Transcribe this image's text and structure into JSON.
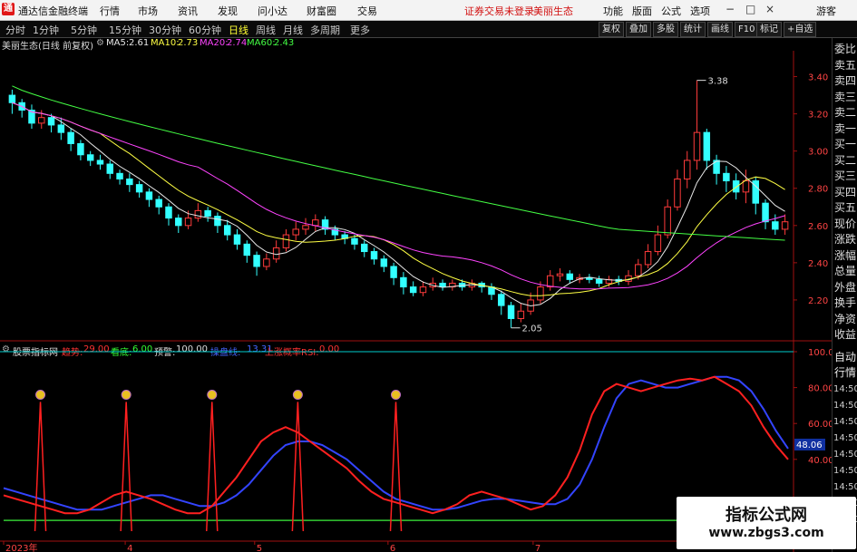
{
  "app": {
    "title": "通达信金融终端",
    "menu": [
      "行情",
      "市场",
      "资讯",
      "发现",
      "问小达",
      "财富圈",
      "交易"
    ],
    "alert": "证券交易未登录",
    "stock_alert": "美丽生态",
    "right_menu": [
      "功能",
      "版面",
      "公式",
      "选项",
      "游客"
    ],
    "window_controls": [
      "−",
      "□",
      "×"
    ]
  },
  "toolbar": {
    "periods": [
      "分时",
      "1分钟",
      "5分钟",
      "15分钟",
      "30分钟",
      "60分钟",
      "日线",
      "周线",
      "月线",
      "多周期",
      "更多"
    ],
    "active_period": "日线",
    "right_buttons": [
      "复权",
      "叠加",
      "多股",
      "统计",
      "画线",
      "F10",
      "标记",
      "+自选"
    ]
  },
  "kline_panel": {
    "stock_name": "美丽生态",
    "info": "(日线 前复权)",
    "ma": [
      {
        "label": "MA5:",
        "value": "2.61",
        "color": "#e8e8e8"
      },
      {
        "label": "MA10:",
        "value": "2.73",
        "color": "#ffff44"
      },
      {
        "label": "MA20:",
        "value": "2.74",
        "color": "#ff44ff"
      },
      {
        "label": "MA60:",
        "value": "2.43",
        "color": "#44ff44"
      }
    ],
    "price_ticks": [
      "3.40",
      "3.20",
      "3.00",
      "2.80",
      "2.60",
      "2.40",
      "2.20"
    ],
    "high_label": "3.38",
    "low_label": "2.05"
  },
  "indicator_panel": {
    "name": "股票指标网",
    "fields": [
      {
        "label": "趋势:",
        "value": "29.00",
        "color": "#ff3333"
      },
      {
        "label": "看底:",
        "value": "6.00",
        "color": "#33ff33"
      },
      {
        "label": "预警:",
        "value": "100.00",
        "color": "#dddddd"
      },
      {
        "label": "操盘线:",
        "value": "13.31",
        "color": "#4466ff"
      },
      {
        "label": "上涨概率RSI:",
        "value": "0.00",
        "color": "#ff3333"
      }
    ],
    "ticks": [
      "100.00",
      "80.00",
      "60.00",
      "40.00"
    ],
    "current_marker": "48.06"
  },
  "x_axis": {
    "labels": [
      "2023年",
      "4",
      "5",
      "6",
      "7"
    ]
  },
  "right_panel": {
    "upper": [
      "委比",
      "卖五",
      "卖四",
      "卖三",
      "卖二",
      "卖一",
      "买一",
      "买二",
      "买三",
      "买四",
      "买五",
      "现价",
      "涨跌",
      "涨幅",
      "总量",
      "外盘",
      "换手",
      "净资",
      "收益"
    ],
    "lower_head": [
      "自动",
      "行情"
    ],
    "times": [
      "14:50",
      "14:50",
      "14:50",
      "14:50",
      "14:50",
      "14:50",
      "14:50",
      "14:50",
      "14:50"
    ]
  },
  "watermark": {
    "line1": "指标公式网",
    "line2": "www.zbgs3.com"
  },
  "colors": {
    "up": "#ff3b3b",
    "down": "#33ffff",
    "ma5": "#e8e8e8",
    "ma10": "#ffff44",
    "ma20": "#ff44ff",
    "ma60": "#44ff44",
    "trend": "#ff2020",
    "operate": "#3344ff",
    "bottom": "#33cc33",
    "warn": "#00cccc",
    "axis": "#a01010"
  },
  "chart_data": {
    "type": "candlestick",
    "period": "daily",
    "y_range": [
      2.05,
      3.45
    ],
    "ma_values": {
      "MA5": 2.61,
      "MA10": 2.73,
      "MA20": 2.74,
      "MA60": 2.43
    },
    "candles": [
      [
        3.3,
        3.26,
        3.33,
        3.2
      ],
      [
        3.26,
        3.22,
        3.28,
        3.18
      ],
      [
        3.22,
        3.15,
        3.25,
        3.12
      ],
      [
        3.15,
        3.18,
        3.22,
        3.12
      ],
      [
        3.18,
        3.14,
        3.2,
        3.1
      ],
      [
        3.14,
        3.1,
        3.18,
        3.06
      ],
      [
        3.1,
        3.04,
        3.12,
        3.0
      ],
      [
        3.04,
        2.98,
        3.06,
        2.95
      ],
      [
        2.98,
        2.95,
        3.0,
        2.92
      ],
      [
        2.95,
        2.93,
        2.98,
        2.9
      ],
      [
        2.93,
        2.88,
        2.95,
        2.85
      ],
      [
        2.88,
        2.85,
        2.9,
        2.82
      ],
      [
        2.85,
        2.82,
        2.88,
        2.78
      ],
      [
        2.82,
        2.78,
        2.84,
        2.75
      ],
      [
        2.78,
        2.74,
        2.8,
        2.7
      ],
      [
        2.74,
        2.7,
        2.76,
        2.66
      ],
      [
        2.7,
        2.64,
        2.72,
        2.6
      ],
      [
        2.64,
        2.6,
        2.66,
        2.56
      ],
      [
        2.6,
        2.64,
        2.68,
        2.58
      ],
      [
        2.64,
        2.68,
        2.72,
        2.62
      ],
      [
        2.68,
        2.65,
        2.7,
        2.62
      ],
      [
        2.65,
        2.6,
        2.67,
        2.56
      ],
      [
        2.6,
        2.55,
        2.63,
        2.52
      ],
      [
        2.55,
        2.5,
        2.58,
        2.47
      ],
      [
        2.5,
        2.44,
        2.52,
        2.4
      ],
      [
        2.44,
        2.38,
        2.46,
        2.33
      ],
      [
        2.38,
        2.42,
        2.45,
        2.36
      ],
      [
        2.42,
        2.48,
        2.52,
        2.4
      ],
      [
        2.48,
        2.55,
        2.58,
        2.46
      ],
      [
        2.55,
        2.58,
        2.62,
        2.52
      ],
      [
        2.58,
        2.6,
        2.64,
        2.55
      ],
      [
        2.6,
        2.63,
        2.66,
        2.57
      ],
      [
        2.63,
        2.58,
        2.65,
        2.55
      ],
      [
        2.58,
        2.55,
        2.6,
        2.52
      ],
      [
        2.55,
        2.53,
        2.57,
        2.5
      ],
      [
        2.53,
        2.5,
        2.55,
        2.47
      ],
      [
        2.5,
        2.46,
        2.52,
        2.43
      ],
      [
        2.46,
        2.42,
        2.48,
        2.39
      ],
      [
        2.42,
        2.38,
        2.44,
        2.35
      ],
      [
        2.38,
        2.32,
        2.4,
        2.28
      ],
      [
        2.32,
        2.27,
        2.35,
        2.23
      ],
      [
        2.27,
        2.24,
        2.3,
        2.22
      ],
      [
        2.24,
        2.27,
        2.3,
        2.22
      ],
      [
        2.27,
        2.29,
        2.32,
        2.25
      ],
      [
        2.29,
        2.27,
        2.31,
        2.25
      ],
      [
        2.27,
        2.29,
        2.31,
        2.25
      ],
      [
        2.29,
        2.27,
        2.31,
        2.25
      ],
      [
        2.27,
        2.29,
        2.31,
        2.25
      ],
      [
        2.29,
        2.27,
        2.3,
        2.24
      ],
      [
        2.27,
        2.23,
        2.29,
        2.2
      ],
      [
        2.23,
        2.17,
        2.25,
        2.12
      ],
      [
        2.17,
        2.1,
        2.19,
        2.05
      ],
      [
        2.1,
        2.14,
        2.18,
        2.08
      ],
      [
        2.14,
        2.2,
        2.24,
        2.12
      ],
      [
        2.2,
        2.27,
        2.3,
        2.18
      ],
      [
        2.27,
        2.33,
        2.36,
        2.25
      ],
      [
        2.33,
        2.34,
        2.37,
        2.3
      ],
      [
        2.34,
        2.31,
        2.36,
        2.29
      ],
      [
        2.31,
        2.32,
        2.34,
        2.29
      ],
      [
        2.32,
        2.31,
        2.34,
        2.29
      ],
      [
        2.31,
        2.29,
        2.33,
        2.27
      ],
      [
        2.29,
        2.31,
        2.33,
        2.27
      ],
      [
        2.31,
        2.3,
        2.33,
        2.28
      ],
      [
        2.3,
        2.33,
        2.36,
        2.28
      ],
      [
        2.33,
        2.39,
        2.42,
        2.31
      ],
      [
        2.39,
        2.46,
        2.5,
        2.37
      ],
      [
        2.46,
        2.55,
        2.6,
        2.44
      ],
      [
        2.55,
        2.7,
        2.74,
        2.53
      ],
      [
        2.7,
        2.85,
        2.9,
        2.68
      ],
      [
        2.85,
        2.95,
        3.0,
        2.8
      ],
      [
        2.95,
        3.1,
        3.38,
        2.9
      ],
      [
        3.1,
        2.95,
        3.12,
        2.9
      ],
      [
        2.95,
        2.88,
        2.98,
        2.82
      ],
      [
        2.88,
        2.84,
        2.92,
        2.78
      ],
      [
        2.84,
        2.78,
        2.88,
        2.74
      ],
      [
        2.78,
        2.84,
        2.9,
        2.72
      ],
      [
        2.84,
        2.72,
        2.86,
        2.66
      ],
      [
        2.72,
        2.62,
        2.74,
        2.58
      ],
      [
        2.62,
        2.58,
        2.66,
        2.55
      ],
      [
        2.58,
        2.62,
        2.66,
        2.55
      ]
    ],
    "indicator": {
      "range": [
        0,
        100
      ],
      "trend": [
        20,
        18,
        16,
        14,
        12,
        10,
        10,
        12,
        16,
        20,
        22,
        20,
        18,
        15,
        12,
        10,
        10,
        14,
        22,
        30,
        40,
        50,
        55,
        58,
        55,
        50,
        45,
        40,
        35,
        28,
        22,
        18,
        16,
        14,
        12,
        10,
        12,
        15,
        20,
        22,
        20,
        18,
        15,
        12,
        14,
        20,
        30,
        45,
        65,
        78,
        82,
        80,
        78,
        80,
        82,
        84,
        85,
        84,
        86,
        82,
        78,
        70,
        58,
        48,
        40
      ],
      "operate": [
        24,
        22,
        20,
        18,
        16,
        14,
        12,
        12,
        12,
        14,
        16,
        18,
        20,
        20,
        18,
        16,
        14,
        14,
        16,
        20,
        26,
        34,
        42,
        48,
        50,
        50,
        48,
        44,
        40,
        34,
        28,
        22,
        18,
        16,
        14,
        12,
        12,
        13,
        15,
        17,
        18,
        18,
        17,
        16,
        15,
        15,
        18,
        26,
        40,
        58,
        74,
        82,
        84,
        82,
        80,
        80,
        82,
        84,
        86,
        86,
        84,
        78,
        68,
        56,
        46
      ],
      "bottom": [
        6,
        6,
        6,
        6,
        6,
        6,
        6,
        6,
        6,
        6,
        6,
        6,
        6,
        6,
        6,
        6,
        6,
        6,
        6,
        6,
        6,
        6,
        6,
        6,
        6,
        6,
        6,
        6,
        6,
        6,
        6,
        6,
        6,
        6,
        6,
        6,
        6,
        6,
        6,
        6,
        6,
        6,
        6,
        6,
        6,
        6,
        6,
        6,
        6,
        6,
        6,
        6,
        6,
        6,
        6,
        6,
        6,
        6,
        6,
        6,
        6,
        6,
        6,
        6,
        6
      ],
      "warn_level": 100,
      "signal_positions": [
        3,
        10,
        17,
        24,
        32
      ]
    }
  }
}
